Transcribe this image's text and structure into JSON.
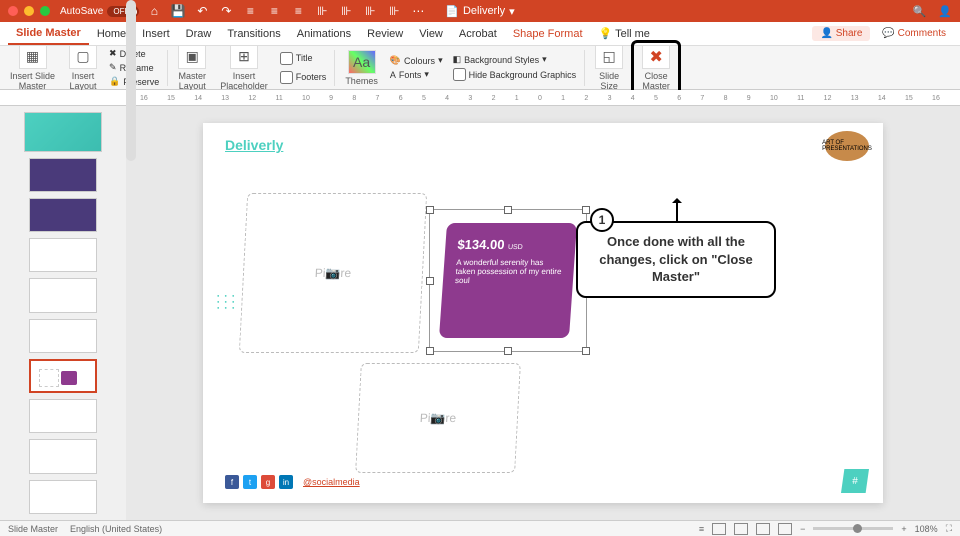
{
  "titlebar": {
    "autosave": "AutoSave",
    "autosave_state": "OFF",
    "doc": "Deliverly"
  },
  "menu": {
    "tabs": [
      "Slide Master",
      "Home",
      "Insert",
      "Draw",
      "Transitions",
      "Animations",
      "Review",
      "View",
      "Acrobat",
      "Shape Format"
    ],
    "tellme": "Tell me",
    "share": "Share",
    "comments": "Comments"
  },
  "ribbon": {
    "insert_slide_master": "Insert Slide\nMaster",
    "insert_layout": "Insert\nLayout",
    "delete": "Delete",
    "rename": "Rename",
    "preserve": "Preserve",
    "master_layout": "Master\nLayout",
    "insert_placeholder": "Insert\nPlaceholder",
    "title": "Title",
    "footers": "Footers",
    "themes": "Themes",
    "colours": "Colours",
    "bg_styles": "Background Styles",
    "fonts": "Fonts",
    "hide_bg": "Hide Background Graphics",
    "slide_size": "Slide\nSize",
    "close_master": "Close\nMaster"
  },
  "slide": {
    "brand": "Deliverly",
    "logo": "ART OF PRESENTATIONS",
    "ph_text": "Pi📷re",
    "card": {
      "price": "$134.00",
      "currency": "USD",
      "desc": "A wonderful serenity has taken possession of my entire soul"
    },
    "social": "@socialmedia",
    "pagenum": "#"
  },
  "callout": {
    "num": "1",
    "text": "Once done with all the changes, click on \"Close Master\""
  },
  "status": {
    "mode": "Slide Master",
    "lang": "English (United States)",
    "zoom": "108%"
  }
}
